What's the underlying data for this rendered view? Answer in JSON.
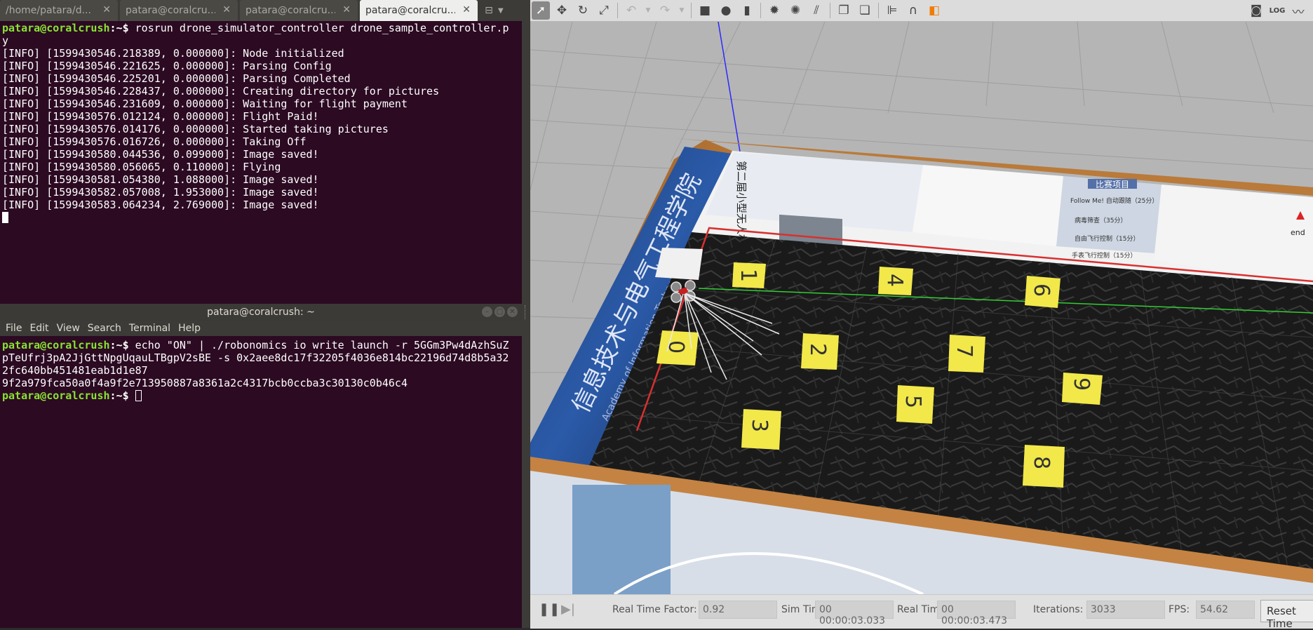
{
  "tabs": [
    {
      "label": "/home/patara/d...",
      "active": false
    },
    {
      "label": "patara@coralcru...",
      "active": false
    },
    {
      "label": "patara@coralcru...",
      "active": false
    },
    {
      "label": "patara@coralcru...",
      "active": true
    }
  ],
  "term1": {
    "prompt_user": "patara@coralcrush",
    "prompt_path": ":~$ ",
    "command": "rosrun drone_simulator_controller drone_sample_controller.py",
    "command_line1": "rosrun drone_simulator_controller drone_sample_controller.p",
    "command_line2": "y",
    "logs": [
      "[INFO] [1599430546.218389, 0.000000]: Node initialized",
      "[INFO] [1599430546.221625, 0.000000]: Parsing Config",
      "[INFO] [1599430546.225201, 0.000000]: Parsing Completed",
      "[INFO] [1599430546.228437, 0.000000]: Creating directory for pictures",
      "[INFO] [1599430546.231609, 0.000000]: Waiting for flight payment",
      "[INFO] [1599430576.012124, 0.000000]: Flight Paid!",
      "[INFO] [1599430576.014176, 0.000000]: Started taking pictures",
      "[INFO] [1599430576.016726, 0.000000]: Taking Off",
      "[INFO] [1599430580.044536, 0.099000]: Image saved!",
      "[INFO] [1599430580.056065, 0.110000]: Flying",
      "[INFO] [1599430581.054380, 1.088000]: Image saved!",
      "[INFO] [1599430582.057008, 1.953000]: Image saved!",
      "[INFO] [1599430583.064234, 2.769000]: Image saved!"
    ]
  },
  "term2": {
    "title": "patara@coralcrush: ~",
    "menu": [
      "File",
      "Edit",
      "View",
      "Search",
      "Terminal",
      "Help"
    ],
    "prompt_user": "patara@coralcrush",
    "prompt_path": ":~$ ",
    "command_lines": [
      "echo \"ON\" | ./robonomics io write launch -r 5GGm3Pw4dAzhSuZ",
      "pTeUfrj3pA2JjGttNpgUqauLTBgpV2sBE -s 0x2aee8dc17f32205f4036e814bc22196d74d8b5a32",
      "2fc640bb451481eab1d1e87"
    ],
    "output": "9f2a979fca50a0f4a9f2e713950887a8361a2c4317bcb0ccba3c30130c0b46c4"
  },
  "gazebo": {
    "toolbar_icons": [
      "select-icon",
      "translate-icon",
      "rotate-icon",
      "scale-icon",
      "undo-icon",
      "undo-menu-icon",
      "redo-icon",
      "redo-menu-icon",
      "box-icon",
      "sphere-icon",
      "cylinder-icon",
      "point-light-icon",
      "spot-light-icon",
      "directional-light-icon",
      "copy-icon",
      "paste-icon",
      "align-icon",
      "snap-icon",
      "change-view-icon",
      "screenshot-icon",
      "log-icon",
      "plot-icon"
    ],
    "scene": {
      "tile_labels": [
        "1",
        "4",
        "6",
        "0",
        "2",
        "7",
        "5",
        "3",
        "8",
        "9"
      ],
      "wall_text_left": "信息技术与电气工程学院",
      "wall_text_left_sub": "Academy of Information Technology",
      "poster_vertical": "第二届小型无人机技术创新竞赛",
      "poster_title": "比赛项目",
      "poster_items": [
        "Follow Me! 自动跟随（25分）",
        "病毒筛查（35分）",
        "自由飞行控制（15分）",
        "手表飞行控制（15分）"
      ],
      "end_label": "end"
    },
    "status": {
      "real_time_factor_label": "Real Time Factor:",
      "real_time_factor": "0.92",
      "sim_time_label": "Sim Time:",
      "sim_time": "00 00:00:03.033",
      "real_time_label": "Real Time:",
      "real_time": "00 00:00:03.473",
      "iterations_label": "Iterations:",
      "iterations": "3033",
      "fps_label": "FPS:",
      "fps": "54.62",
      "reset_label": "Reset Time"
    }
  }
}
